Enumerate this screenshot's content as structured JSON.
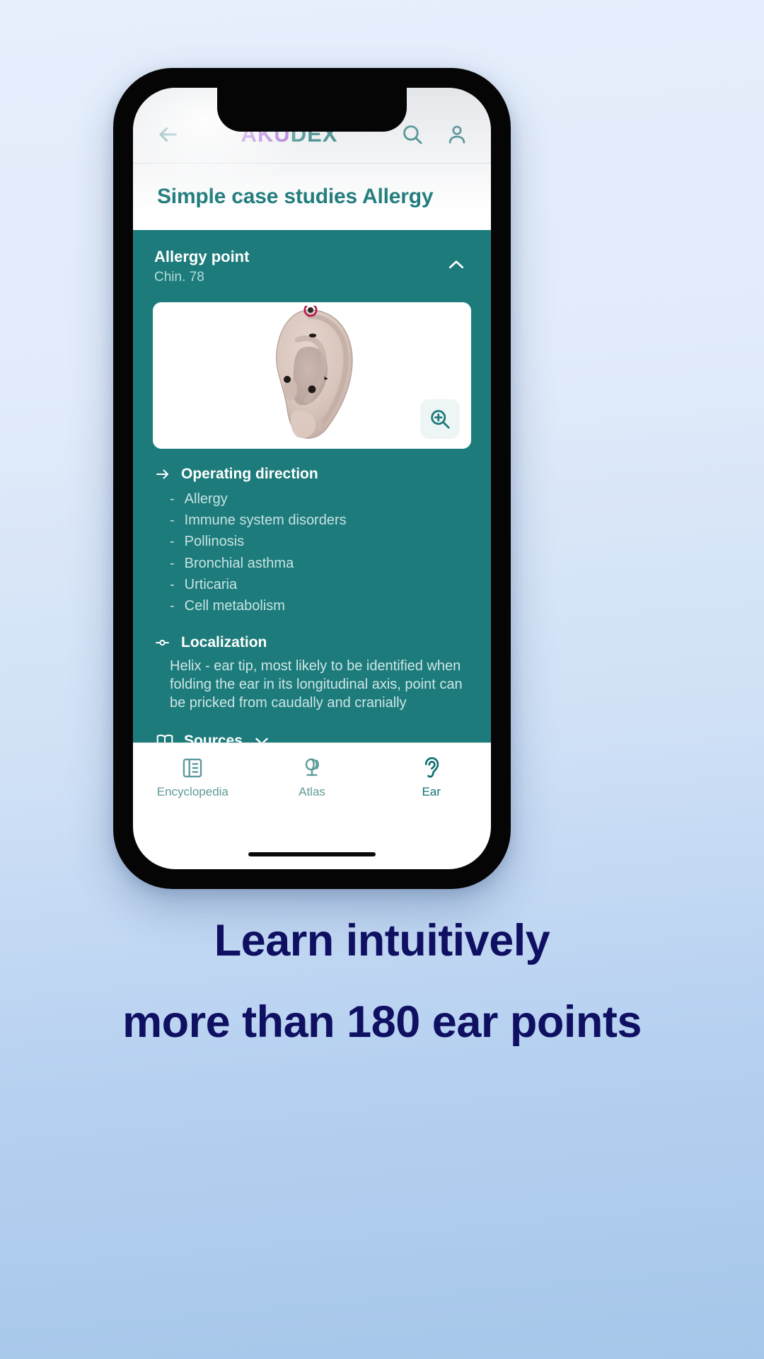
{
  "header": {
    "back_icon": "arrow-left-icon",
    "logo_part1": "AKU",
    "logo_part2": "DEX",
    "search_icon": "search-icon",
    "profile_icon": "person-icon"
  },
  "page": {
    "title": "Simple case studies Allergy"
  },
  "accordion": {
    "title": "Allergy point",
    "subtitle": "Chin. 78",
    "chevron_icon": "chevron-up-icon",
    "expanded": true
  },
  "image_card": {
    "alt": "ear-anatomy-illustration",
    "zoom_icon": "zoom-in-icon"
  },
  "sections": [
    {
      "icon": "arrow-right-icon",
      "label": "Operating direction",
      "type": "list",
      "items": [
        "Allergy",
        "Immune system disorders",
        "Pollinosis",
        "Bronchial asthma",
        "Urticaria",
        "Cell metabolism"
      ],
      "bullet_char": "-"
    },
    {
      "icon": "point-marker-icon",
      "label": "Localization",
      "type": "paragraph",
      "text": "Helix - ear tip, most likely to be identified when folding the ear in its longitudinal axis, point can be pricked from caudally and cranially"
    }
  ],
  "sources": {
    "icon": "book-icon",
    "label": "Sources",
    "chevron_icon": "chevron-down-icon"
  },
  "tabbar": {
    "tabs": [
      {
        "label": "Encyclopedia",
        "icon": "book-open-icon",
        "active": false
      },
      {
        "label": "Atlas",
        "icon": "globe-icon",
        "active": false
      },
      {
        "label": "Ear",
        "icon": "ear-icon",
        "active": true
      }
    ]
  },
  "marketing": {
    "line1": "Learn intuitively",
    "line2": "more than 180 ear points"
  },
  "colors": {
    "teal": "#1d7b7b",
    "teal_dark": "#187878",
    "purple": "#9b3fd4",
    "navy": "#101063",
    "tab_inactive": "#5f9a9a",
    "point_highlight": "#b5184b"
  }
}
